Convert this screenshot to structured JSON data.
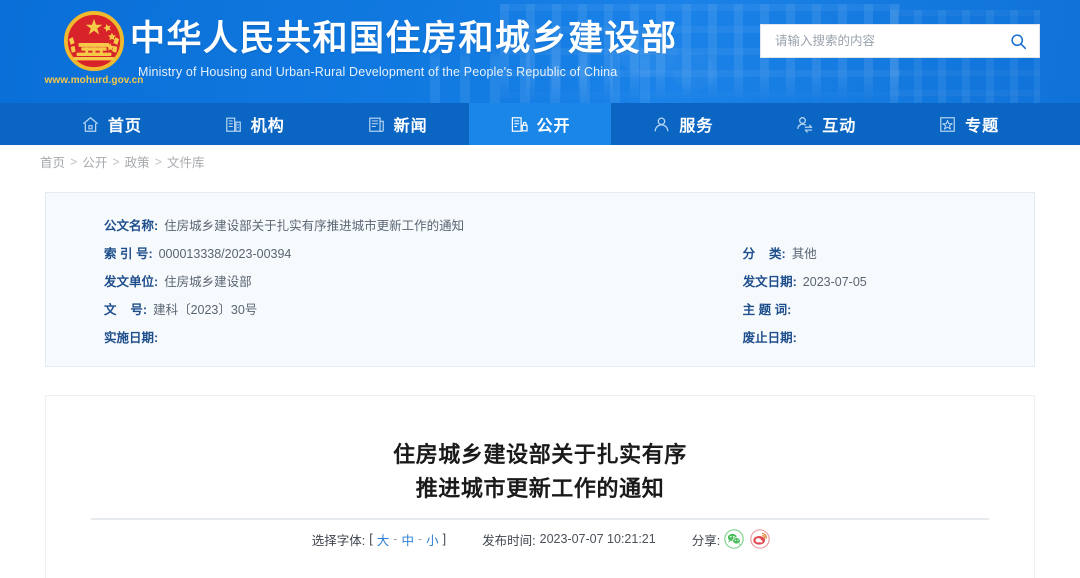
{
  "header": {
    "emblem_icon": "china-national-emblem",
    "gov_url": "www.mohurd.gov.cn",
    "title_cn": "中华人民共和国住房和城乡建设部",
    "title_en": "Ministry of Housing and Urban-Rural Development of the People's Republic of China",
    "search": {
      "placeholder": "请输入搜索的内容",
      "value": "",
      "icon": "search-icon"
    }
  },
  "nav": {
    "active_index": 3,
    "items": [
      {
        "label": "首页",
        "icon": "home-icon"
      },
      {
        "label": "机构",
        "icon": "building-icon"
      },
      {
        "label": "新闻",
        "icon": "news-icon"
      },
      {
        "label": "公开",
        "icon": "open-info-icon"
      },
      {
        "label": "服务",
        "icon": "service-person-icon"
      },
      {
        "label": "互动",
        "icon": "interaction-icon"
      },
      {
        "label": "专题",
        "icon": "star-topic-icon"
      }
    ]
  },
  "breadcrumb": {
    "items": [
      "首页",
      "公开",
      "政策",
      "文件库"
    ],
    "separator": ">"
  },
  "meta": {
    "rows": [
      {
        "left_label": "公文名称:",
        "left_value": "住房城乡建设部关于扎实有序推进城市更新工作的通知",
        "right_label": "",
        "right_value": ""
      },
      {
        "left_label": "索 引 号:",
        "left_value": "000013338/2023-00394",
        "right_label": "分    类:",
        "right_value": "其他"
      },
      {
        "left_label": "发文单位:",
        "left_value": "住房城乡建设部",
        "right_label": "发文日期:",
        "right_value": "2023-07-05"
      },
      {
        "left_label": "文    号:",
        "left_value": "建科〔2023〕30号",
        "right_label": "主 题 词:",
        "right_value": ""
      },
      {
        "left_label": "实施日期:",
        "left_value": "",
        "right_label": "废止日期:",
        "right_value": ""
      }
    ]
  },
  "article": {
    "title_line1": "住房城乡建设部关于扎实有序",
    "title_line2": "推进城市更新工作的通知",
    "toolbar": {
      "fontsize_label": "选择字体:",
      "bracket_open": "[",
      "bracket_close": "]",
      "size_large": "大",
      "size_medium": "中",
      "size_small": "小",
      "dash": "-",
      "publish_label": "发布时间:",
      "publish_time": "2023-07-07 10:21:21",
      "share_label": "分享:",
      "share_wechat_icon": "wechat-share-icon",
      "share_weibo_icon": "weibo-share-icon"
    }
  },
  "colors": {
    "brand_blue": "#0b65c2",
    "nav_active": "#1a86e8",
    "header_blue": "#1079e0",
    "meta_label": "#1f4e8c",
    "link_blue": "#2b7fd4",
    "emblem_gold": "#f6c948",
    "emblem_red": "#d8232a",
    "wechat_green": "#4bbd5c",
    "weibo_red": "#e04a52"
  }
}
